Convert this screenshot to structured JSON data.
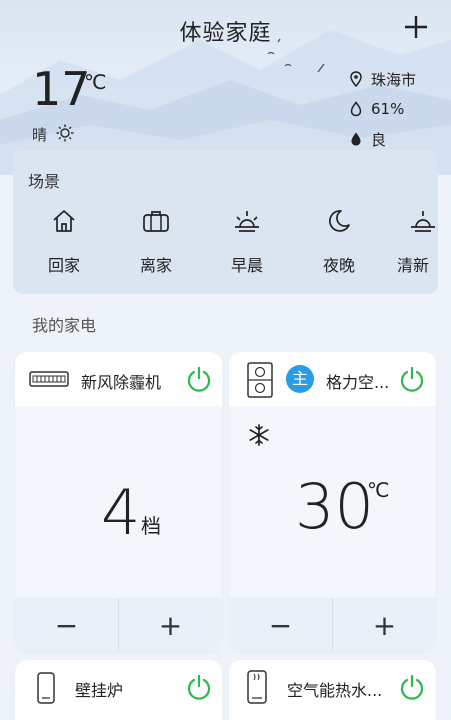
{
  "header": {
    "title": "体验家庭",
    "add_icon": "plus-icon"
  },
  "weather": {
    "temperature": "17",
    "unit": "℃",
    "condition": "晴",
    "city": "珠海市",
    "humidity": "61%",
    "air_quality": "良"
  },
  "scenes": {
    "title": "场景",
    "items": [
      {
        "label": "回家",
        "icon": "home-icon"
      },
      {
        "label": "离家",
        "icon": "briefcase-icon"
      },
      {
        "label": "早晨",
        "icon": "sunrise-icon"
      },
      {
        "label": "夜晚",
        "icon": "moon-icon"
      },
      {
        "label": "清新",
        "icon": "sunrise-icon"
      }
    ]
  },
  "devices": {
    "title": "我的家电",
    "cards": [
      {
        "name": "新风除霾机",
        "value": "4",
        "unit": "档",
        "minus": "−",
        "plus": "+"
      },
      {
        "name": "格力空...",
        "badge": "主",
        "value": "30",
        "unit": "℃",
        "minus": "−",
        "plus": "+"
      },
      {
        "name": "壁挂炉"
      },
      {
        "name": "空气能热水..."
      }
    ]
  },
  "colors": {
    "power_green": "#2db84d",
    "badge_blue": "#2a9ce6"
  }
}
